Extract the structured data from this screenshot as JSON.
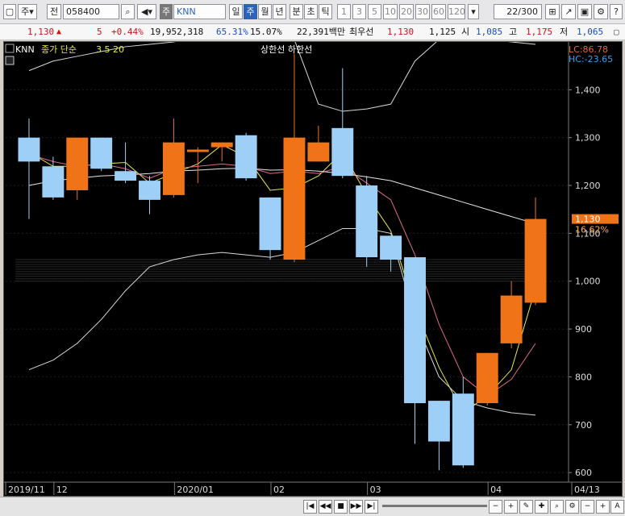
{
  "toolbar": {
    "period_label": "주",
    "prefix_label": "전",
    "code": "058400",
    "stock_tag": "주",
    "stock_name": "KNN",
    "period_buttons": [
      "일",
      "주",
      "월",
      "년",
      "분",
      "초",
      "틱"
    ],
    "interval_buttons": [
      "1",
      "3",
      "5",
      "10",
      "20",
      "30",
      "60",
      "120"
    ],
    "page_counter": "22/300"
  },
  "ticker": {
    "price": "1,130",
    "change": "5",
    "change_pct": "+0.44%",
    "volume": "19,952,318",
    "ratio1": "65.31%",
    "ratio2": "15.07%",
    "amount": "22,391백만",
    "best_label": "최우선",
    "best_price": "1,130",
    "best2": "1,125",
    "open_label": "시",
    "open": "1,085",
    "high_label": "고",
    "high": "1,175",
    "low_label": "저",
    "low": "1,065"
  },
  "chart_header": {
    "symbol": "KNN",
    "ma_label": "종가 단순",
    "ma_periods": "3  5  20",
    "band_labels": "상한선  하한선",
    "lc_label": "LC:86.78",
    "hc_label": "HC:-23.65",
    "current_price": "1,130",
    "current_pct": "16.62%"
  },
  "chart_data": {
    "type": "candlestick",
    "x_labels": [
      "2019/11",
      "12",
      "2020/01",
      "02",
      "03",
      "04",
      "04/13"
    ],
    "y_ticks": [
      600,
      700,
      800,
      900,
      1000,
      1100,
      1200,
      1300,
      1400
    ],
    "ylim": [
      580,
      1500
    ],
    "candles": [
      {
        "o": 1300,
        "c": 1250,
        "h": 1340,
        "l": 1130
      },
      {
        "o": 1240,
        "c": 1175,
        "h": 1260,
        "l": 1170
      },
      {
        "o": 1190,
        "c": 1300,
        "h": 1300,
        "l": 1170
      },
      {
        "o": 1300,
        "c": 1235,
        "h": 1300,
        "l": 1230
      },
      {
        "o": 1230,
        "c": 1210,
        "h": 1290,
        "l": 1205
      },
      {
        "o": 1210,
        "c": 1170,
        "h": 1220,
        "l": 1140
      },
      {
        "o": 1180,
        "c": 1290,
        "h": 1340,
        "l": 1175
      },
      {
        "o": 1270,
        "c": 1275,
        "h": 1280,
        "l": 1205
      },
      {
        "o": 1280,
        "c": 1290,
        "h": 1290,
        "l": 1250
      },
      {
        "o": 1305,
        "c": 1215,
        "h": 1310,
        "l": 1210
      },
      {
        "o": 1175,
        "c": 1065,
        "h": 1175,
        "l": 1045
      },
      {
        "o": 1045,
        "c": 1300,
        "h": 1475,
        "l": 1040
      },
      {
        "o": 1250,
        "c": 1290,
        "h": 1325,
        "l": 1250
      },
      {
        "o": 1320,
        "c": 1220,
        "h": 1445,
        "l": 1215
      },
      {
        "o": 1200,
        "c": 1050,
        "h": 1220,
        "l": 1030
      },
      {
        "o": 1095,
        "c": 1045,
        "h": 1095,
        "l": 1020
      },
      {
        "o": 1050,
        "c": 745,
        "h": 1050,
        "l": 660
      },
      {
        "o": 750,
        "c": 665,
        "h": 750,
        "l": 605
      },
      {
        "o": 765,
        "c": 615,
        "h": 800,
        "l": 610
      },
      {
        "o": 745,
        "c": 850,
        "h": 850,
        "l": 740
      },
      {
        "o": 870,
        "c": 970,
        "h": 1000,
        "l": 860
      },
      {
        "o": 955,
        "c": 1130,
        "h": 1175,
        "l": 950
      }
    ],
    "series": [
      {
        "name": "3",
        "color": "#e8e84a",
        "values": [
          1270,
          1240,
          1240,
          1245,
          1248,
          1205,
          1225,
          1245,
          1285,
          1260,
          1190,
          1195,
          1220,
          1270,
          1180,
          1105,
          945,
          820,
          725,
          760,
          815,
          985
        ]
      },
      {
        "name": "5",
        "color": "#e06a8a",
        "values": [
          1265,
          1250,
          1240,
          1245,
          1235,
          1215,
          1235,
          1240,
          1245,
          1240,
          1225,
          1230,
          1225,
          1240,
          1205,
          1170,
          1055,
          910,
          800,
          760,
          795,
          870
        ]
      },
      {
        "name": "20",
        "color": "#e6e6e6",
        "values": [
          1200,
          1210,
          1215,
          1220,
          1222,
          1225,
          1230,
          1232,
          1235,
          1236,
          1232,
          1233,
          1230,
          1225,
          1218,
          1210,
          1195,
          1180,
          1165,
          1150,
          1135,
          1120
        ]
      },
      {
        "name": "상한선",
        "color": "#d8d8d8",
        "values": [
          1440,
          1460,
          1470,
          1480,
          1490,
          1495,
          1500,
          1510,
          1515,
          1520,
          1510,
          1505,
          1370,
          1355,
          1360,
          1370,
          1460,
          1505,
          1510,
          1505,
          1500,
          1495
        ]
      },
      {
        "name": "하한선",
        "color": "#d8d8d8",
        "values": [
          815,
          835,
          870,
          920,
          980,
          1030,
          1045,
          1055,
          1060,
          1055,
          1050,
          1060,
          1085,
          1110,
          1110,
          1100,
          920,
          800,
          750,
          735,
          725,
          720
        ]
      }
    ],
    "hist_pattern": [
      1045,
      1040,
      1035,
      1030,
      1025,
      1020,
      1015,
      1010,
      1005,
      1000
    ]
  },
  "bottom": {
    "buttons": [
      "|◀",
      "◀◀",
      "■",
      "▶▶",
      "▶|"
    ]
  }
}
